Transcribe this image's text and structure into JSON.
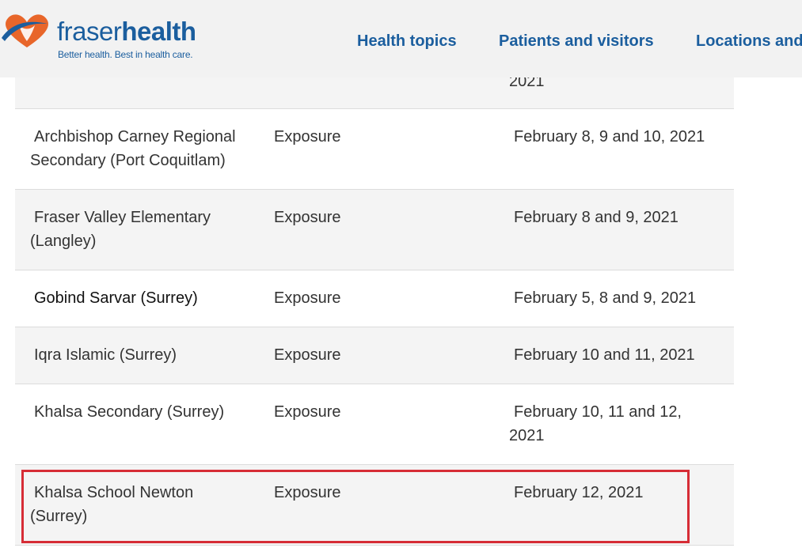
{
  "header": {
    "brand_part1": "fraser",
    "brand_part2": "health",
    "tagline": "Better health. Best in health care.",
    "nav": [
      "Health topics",
      "Patients and visitors",
      "Locations and"
    ]
  },
  "table": {
    "partial_row_date": "2021",
    "rows": [
      {
        "school_line1": "Archbishop Carney Regional",
        "school_line2": "Secondary (Port Coquitlam)",
        "type": "Exposure",
        "date_line1": "February 8, 9 and 10, 2021",
        "date_line2": ""
      },
      {
        "school_line1": "Fraser Valley Elementary",
        "school_line2": "(Langley)",
        "type": "Exposure",
        "date_line1": "February 8 and 9, 2021",
        "date_line2": ""
      },
      {
        "school_line1": "Gobind Sarvar (Surrey)",
        "school_line2": "",
        "type": "Exposure",
        "date_line1": "February 5, 8 and 9, 2021",
        "date_line2": ""
      },
      {
        "school_line1": "Iqra Islamic (Surrey)",
        "school_line2": "",
        "type": "Exposure",
        "date_line1": "February 10 and 11, 2021",
        "date_line2": ""
      },
      {
        "school_line1": "Khalsa Secondary (Surrey)",
        "school_line2": "",
        "type": "Exposure",
        "date_line1": "February 10, 11 and 12,",
        "date_line2": "2021"
      },
      {
        "school_line1": "Khalsa School Newton",
        "school_line2": "(Surrey)",
        "type": "Exposure",
        "date_line1": "February 12, 2021",
        "date_line2": ""
      }
    ]
  },
  "colors": {
    "brand_blue": "#1b5e9e",
    "logo_orange": "#e8662a",
    "highlight_red": "#d62d36"
  }
}
